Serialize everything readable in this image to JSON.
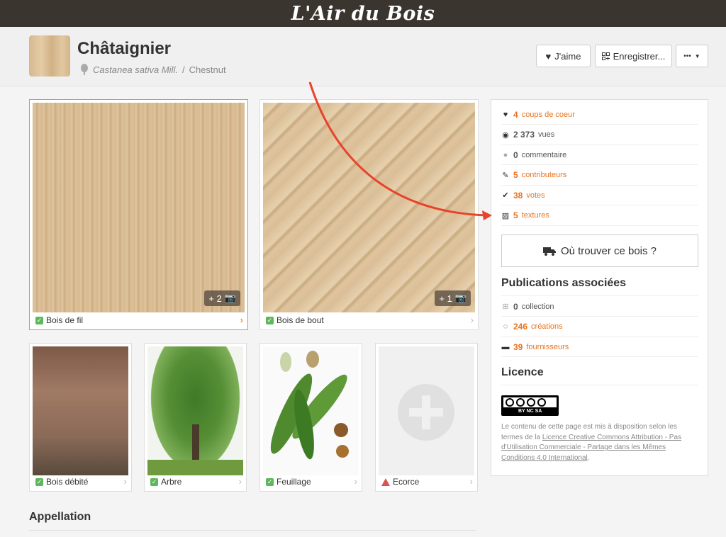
{
  "topbar": {
    "logo": "L'Air du Bois"
  },
  "header": {
    "title": "Châtaignier",
    "latin_name": "Castanea sativa Mill.",
    "separator": " / ",
    "english_name": "Chestnut",
    "like_label": "J'aime",
    "save_label": "Enregistrer...",
    "more_label": "•••"
  },
  "gallery": {
    "main": [
      {
        "label": "Bois de fil",
        "badge": "+ 2",
        "status": "ok"
      },
      {
        "label": "Bois de bout",
        "badge": "+ 1",
        "status": "ok"
      }
    ],
    "small": [
      {
        "label": "Bois débité",
        "status": "ok"
      },
      {
        "label": "Arbre",
        "status": "ok"
      },
      {
        "label": "Feuillage",
        "status": "ok"
      },
      {
        "label": "Ecorce",
        "status": "warning"
      }
    ]
  },
  "stats": [
    {
      "icon": "heart-icon",
      "num": "4",
      "text": "coups de coeur",
      "accent": true
    },
    {
      "icon": "eye-icon",
      "num": "2 373",
      "text": "vues",
      "accent": false
    },
    {
      "icon": "comment-icon",
      "num": "0",
      "text": "commentaire",
      "accent": false
    },
    {
      "icon": "contributors-icon",
      "num": "5",
      "text": "contributeurs",
      "accent": true
    },
    {
      "icon": "check-icon",
      "num": "38",
      "text": "votes",
      "accent": true
    },
    {
      "icon": "texture-icon",
      "num": "5",
      "text": "textures",
      "accent": true
    }
  ],
  "where_button": "Où trouver ce bois ?",
  "publications": {
    "title": "Publications associées",
    "items": [
      {
        "icon": "collection-icon",
        "num": "0",
        "text": "collection",
        "accent": false
      },
      {
        "icon": "creation-icon",
        "num": "246",
        "text": "créations",
        "accent": true
      },
      {
        "icon": "truck-icon",
        "num": "39",
        "text": "fournisseurs",
        "accent": true
      }
    ]
  },
  "licence": {
    "title": "Licence",
    "cc_text": "BY  NC  SA",
    "text_before": "Le contenu de cette page est mis à disposition selon les termes de la ",
    "link": "Licence Creative Commons Attribution - Pas d'Utilisation Commerciale - Partage dans les Mêmes Conditions 4.0 International",
    "text_after": "."
  },
  "appellation": {
    "title": "Appellation"
  },
  "colors": {
    "accent": "#e8731f",
    "topbar": "#3b3530",
    "ok": "#5cb85c",
    "warning": "#d9534f",
    "arrow": "#e8432c"
  }
}
